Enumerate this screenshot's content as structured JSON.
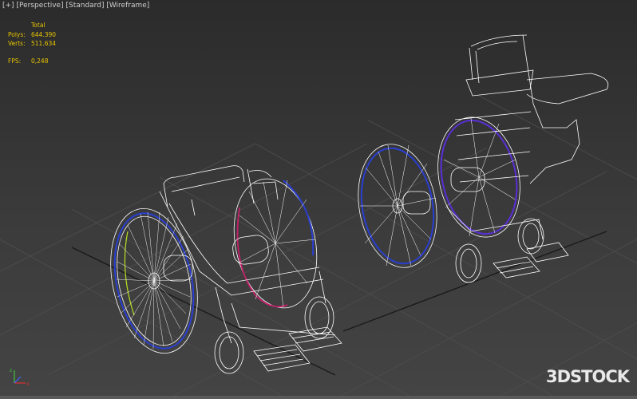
{
  "viewport": {
    "labels": {
      "plus": "[+]",
      "view": "[Perspective]",
      "shading": "[Standard]",
      "mode": "[Wireframe]"
    },
    "stats": {
      "header": "Total",
      "polys_label": "Polys:",
      "polys_value": "644.390",
      "verts_label": "Verts:",
      "verts_value": "511.634",
      "fps_label": "FPS:",
      "fps_value": "0,248"
    },
    "watermark": "3DSTOCK"
  },
  "colors": {
    "background": "#333333",
    "grid": "#4a4a4a",
    "wire": "#ffffff",
    "stats_text": "#e8c400",
    "rim_blue": "#2a3fd0",
    "rim_magenta": "#c4206a",
    "rim_purple": "#5a2fd6",
    "rim_green": "#b8e020"
  },
  "icons": [
    "axis-gizmo-icon"
  ]
}
